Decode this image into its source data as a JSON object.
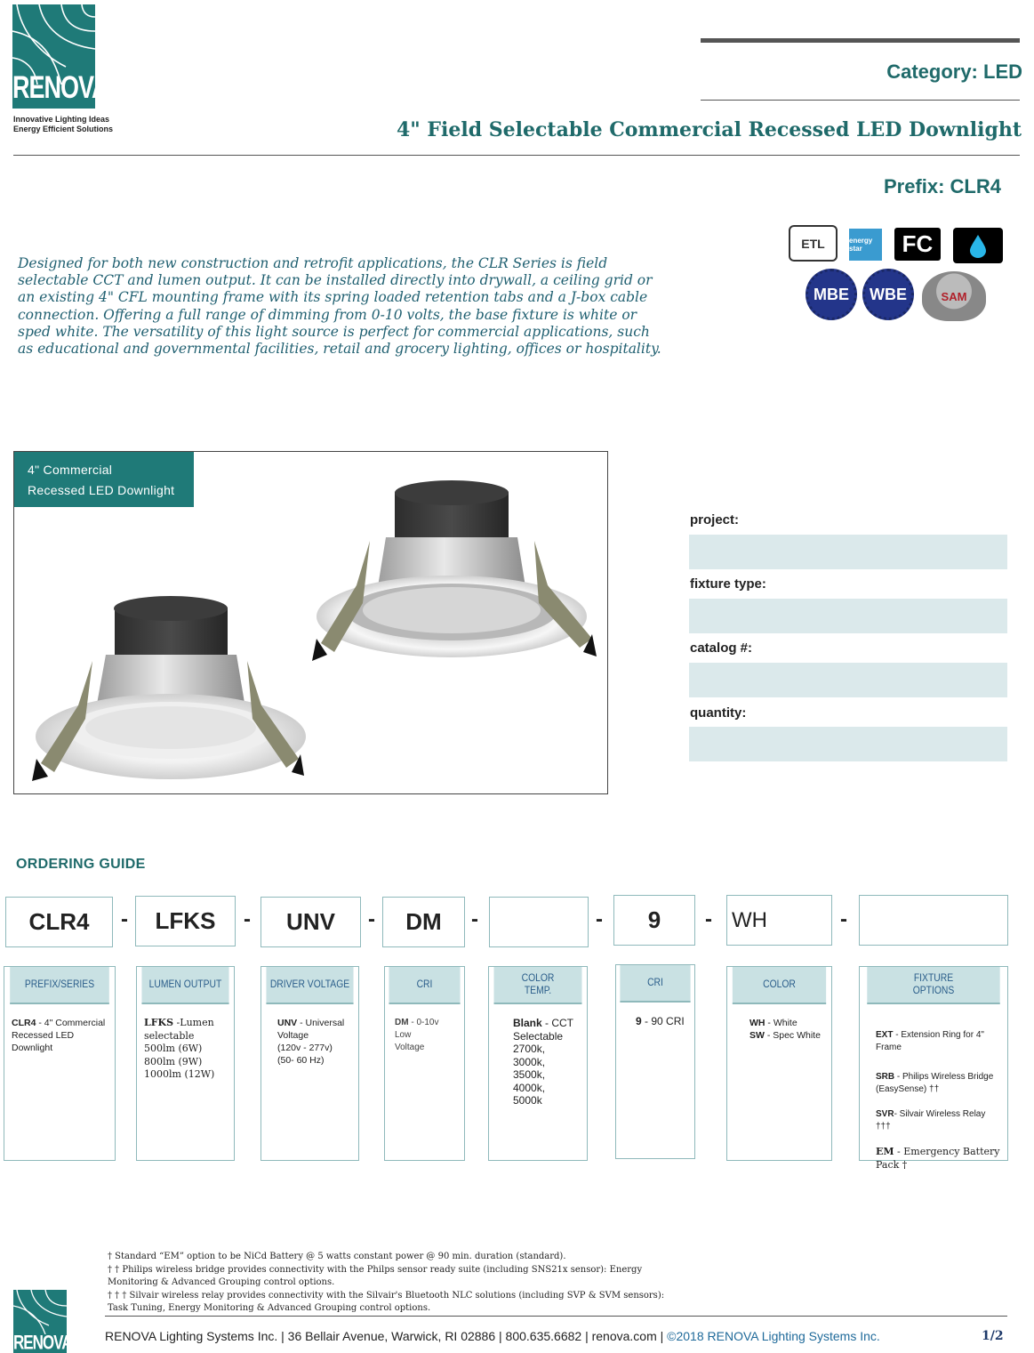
{
  "brand": {
    "logo_text": "RENOVA",
    "tagline_1": "Innovative Lighting Ideas",
    "tagline_2": "Energy Efficient Solutions"
  },
  "header": {
    "category": "Category: LED",
    "title": "4\" Field Selectable Commercial Recessed LED Downlight",
    "prefix": "Prefix: CLR4"
  },
  "description": "Designed for both new construction and retrofit applications, the CLR Series is field selectable CCT and lumen output. It can be installed directly into drywall, a ceiling grid or an existing 4\" CFL mounting frame with its spring loaded retention tabs and a J-box cable connection. Offering a full range of dimming from 0-10 volts, the base fixture is white or sped white. The versatility of this light source is perfect for commercial applications, such as educational and governmental facilities, retail and grocery lighting, offices or hospitality.",
  "certifications": {
    "etl": "ETL",
    "energy_star": "energy star",
    "fcc": "FC",
    "mbe": "MBE",
    "wbe": "WBE",
    "sam": "SAM"
  },
  "product_image": {
    "tag_line_1": "4\" Commercial",
    "tag_line_2": "Recessed  LED Downlight"
  },
  "form": {
    "project_label": "project:",
    "fixture_type_label": "fixture type:",
    "catalog_label": "catalog #:",
    "quantity_label": "quantity:"
  },
  "ordering_guide": {
    "title": "ORDERING GUIDE",
    "codes": [
      "CLR4",
      "LFKS",
      "UNV",
      "DM",
      "",
      "9",
      "WH",
      ""
    ],
    "separator": "-",
    "columns": [
      {
        "header": "PREFIX/SERIES",
        "body_key": "CLR4",
        "body_text": " - 4\" Commercial\nRecessed LED Downlight"
      },
      {
        "header": "LUMEN OUTPUT",
        "body_key": "LFKS",
        "body_text": " -Lumen\nselectable\n500lm (6W)\n800lm (9W)\n1000lm (12W)"
      },
      {
        "header": "DRIVER VOLTAGE",
        "body_key": "UNV",
        "body_text": " - Universal\nVoltage\n(120v - 277v)\n(50- 60 Hz)"
      },
      {
        "header": "CRI",
        "body_key": "DM",
        "body_text": " - 0-10v Low\nVoltage"
      },
      {
        "header": "COLOR\nTEMP.",
        "body_key": "Blank",
        "body_text": " - CCT\nSelectable\n2700k,\n3000k,\n3500k,\n4000k,\n5000k"
      },
      {
        "header": "CRI",
        "body_key": "9",
        "body_text": " - 90 CRI"
      },
      {
        "header": "COLOR",
        "body_key": "WH",
        "body_text": " - White",
        "body_key_2": "SW",
        "body_text_2": " - Spec White"
      },
      {
        "header": "FIXTURE\nOPTIONS",
        "options": [
          {
            "key": "EXT",
            "text": " - Extension Ring  for 4\" Frame"
          },
          {
            "key": "SRB",
            "text": " - Philips Wireless Bridge\n(EasySense) ††"
          },
          {
            "key": "SVR",
            "text": "- Silvair Wireless Relay\n†††"
          },
          {
            "key": "EM",
            "text": " - Emergency Battery Pack †"
          }
        ]
      }
    ]
  },
  "footnotes": {
    "note_1": "† Standard “EM” option to be NiCd Battery @ 5 watts constant power @ 90 min. duration (standard).",
    "note_2": "† † Philips wireless bridge provides connectivity with the Philps sensor ready suite (including SNS21x sensor): Energy Monitoring & Advanced Grouping control options.",
    "note_3": "† † †  Silvair wireless relay provides connectivity with the Silvair's Bluetooth NLC solutions (including SVP & SVM sensors): Task Tuning, Energy Monitoring & Advanced Grouping control options."
  },
  "footer": {
    "company_line": "RENOVA Lighting Systems Inc. | 36 Bellair Avenue, Warwick, RI 02886 | 800.635.6682 | renova.com | ",
    "copyright": "©2018 RENOVA Lighting Systems Inc.",
    "page": "1/2",
    "logo_text": "RENOVA"
  },
  "colors": {
    "brand_teal": "#1f7a78",
    "heading_teal": "#1f6a6a",
    "field_fill": "#dbe9eb",
    "column_header_fill": "#c9e1e3"
  }
}
